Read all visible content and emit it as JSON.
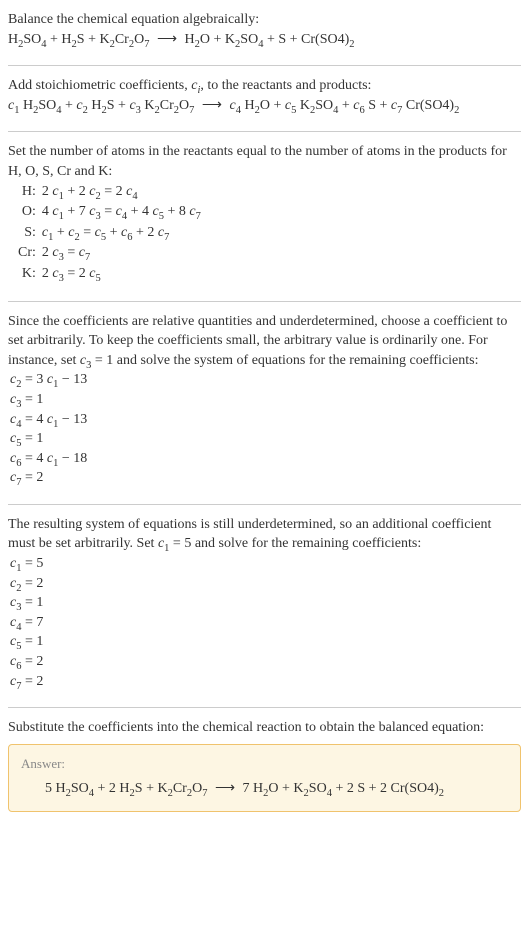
{
  "intro": {
    "line1": "Balance the chemical equation algebraically:",
    "eq_html": "H<sub>2</sub>SO<sub>4</sub> + H<sub>2</sub>S + K<sub>2</sub>Cr<sub>2</sub>O<sub>7</sub> <span class='arrow'>⟶</span> H<sub>2</sub>O + K<sub>2</sub>SO<sub>4</sub> + S + Cr(SO4)<sub>2</sub>"
  },
  "stoich": {
    "line1_html": "Add stoichiometric coefficients, <span class='ital'>c<sub>i</sub></span>, to the reactants and products:",
    "eq_html": "<span class='ital'>c</span><sub>1</sub> H<sub>2</sub>SO<sub>4</sub> + <span class='ital'>c</span><sub>2</sub> H<sub>2</sub>S + <span class='ital'>c</span><sub>3</sub> K<sub>2</sub>Cr<sub>2</sub>O<sub>7</sub> <span class='arrow'>⟶</span> <span class='ital'>c</span><sub>4</sub> H<sub>2</sub>O + <span class='ital'>c</span><sub>5</sub> K<sub>2</sub>SO<sub>4</sub> + <span class='ital'>c</span><sub>6</sub> S + <span class='ital'>c</span><sub>7</sub> Cr(SO4)<sub>2</sub>"
  },
  "atoms": {
    "intro": "Set the number of atoms in the reactants equal to the number of atoms in the products for H, O, S, Cr and K:",
    "rows": [
      {
        "label": "H:",
        "eq_html": "2 <span class='ital'>c</span><sub>1</sub> + 2 <span class='ital'>c</span><sub>2</sub> = 2 <span class='ital'>c</span><sub>4</sub>"
      },
      {
        "label": "O:",
        "eq_html": "4 <span class='ital'>c</span><sub>1</sub> + 7 <span class='ital'>c</span><sub>3</sub> = <span class='ital'>c</span><sub>4</sub> + 4 <span class='ital'>c</span><sub>5</sub> + 8 <span class='ital'>c</span><sub>7</sub>"
      },
      {
        "label": "S:",
        "eq_html": "<span class='ital'>c</span><sub>1</sub> + <span class='ital'>c</span><sub>2</sub> = <span class='ital'>c</span><sub>5</sub> + <span class='ital'>c</span><sub>6</sub> + 2 <span class='ital'>c</span><sub>7</sub>"
      },
      {
        "label": "Cr:",
        "eq_html": "2 <span class='ital'>c</span><sub>3</sub> = <span class='ital'>c</span><sub>7</sub>"
      },
      {
        "label": "K:",
        "eq_html": "2 <span class='ital'>c</span><sub>3</sub> = 2 <span class='ital'>c</span><sub>5</sub>"
      }
    ]
  },
  "underdet1": {
    "intro_html": "Since the coefficients are relative quantities and underdetermined, choose a coefficient to set arbitrarily. To keep the coefficients small, the arbitrary value is ordinarily one. For instance, set <span class='ital'>c</span><sub>3</sub> = 1 and solve the system of equations for the remaining coefficients:",
    "lines_html": [
      "<span class='ital'>c</span><sub>2</sub> = 3 <span class='ital'>c</span><sub>1</sub> − 13",
      "<span class='ital'>c</span><sub>3</sub> = 1",
      "<span class='ital'>c</span><sub>4</sub> = 4 <span class='ital'>c</span><sub>1</sub> − 13",
      "<span class='ital'>c</span><sub>5</sub> = 1",
      "<span class='ital'>c</span><sub>6</sub> = 4 <span class='ital'>c</span><sub>1</sub> − 18",
      "<span class='ital'>c</span><sub>7</sub> = 2"
    ]
  },
  "underdet2": {
    "intro_html": "The resulting system of equations is still underdetermined, so an additional coefficient must be set arbitrarily. Set <span class='ital'>c</span><sub>1</sub> = 5 and solve for the remaining coefficients:",
    "lines_html": [
      "<span class='ital'>c</span><sub>1</sub> = 5",
      "<span class='ital'>c</span><sub>2</sub> = 2",
      "<span class='ital'>c</span><sub>3</sub> = 1",
      "<span class='ital'>c</span><sub>4</sub> = 7",
      "<span class='ital'>c</span><sub>5</sub> = 1",
      "<span class='ital'>c</span><sub>6</sub> = 2",
      "<span class='ital'>c</span><sub>7</sub> = 2"
    ]
  },
  "final": {
    "intro": "Substitute the coefficients into the chemical reaction to obtain the balanced equation:",
    "answer_label": "Answer:",
    "answer_html": "5 H<sub>2</sub>SO<sub>4</sub> + 2 H<sub>2</sub>S + K<sub>2</sub>Cr<sub>2</sub>O<sub>7</sub> <span class='arrow'>⟶</span> 7 H<sub>2</sub>O + K<sub>2</sub>SO<sub>4</sub> + 2 S + 2 Cr(SO4)<sub>2</sub>"
  }
}
